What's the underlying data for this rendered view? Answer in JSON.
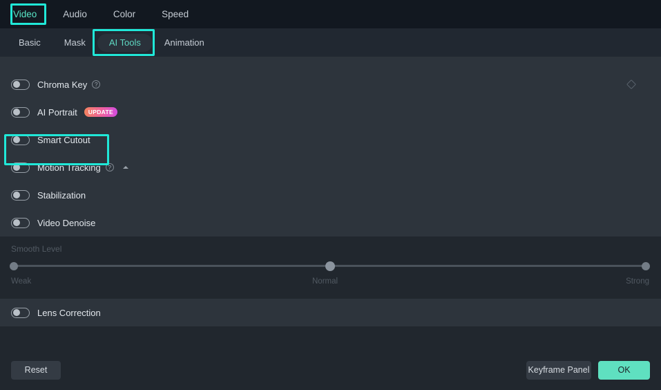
{
  "top_tabs": [
    {
      "label": "Video",
      "active": true,
      "highlighted": true
    },
    {
      "label": "Audio",
      "active": false,
      "highlighted": false
    },
    {
      "label": "Color",
      "active": false,
      "highlighted": false
    },
    {
      "label": "Speed",
      "active": false,
      "highlighted": false
    }
  ],
  "sub_tabs": [
    {
      "label": "Basic",
      "active": false
    },
    {
      "label": "Mask",
      "active": false
    },
    {
      "label": "AI Tools",
      "active": true
    },
    {
      "label": "Animation",
      "active": false
    }
  ],
  "rows": {
    "chroma_key": {
      "label": "Chroma Key",
      "help": "?",
      "keyframe_icon": "diamond-icon",
      "toggle": "off"
    },
    "ai_portrait": {
      "label": "AI Portrait",
      "badge": "UPDATE",
      "toggle": "off"
    },
    "smart_cutout": {
      "label": "Smart Cutout",
      "toggle": "off"
    },
    "motion_tracking": {
      "label": "Motion Tracking",
      "help": "?",
      "caret": "collapse-caret",
      "toggle": "off"
    },
    "stabilization": {
      "label": "Stabilization",
      "toggle": "off"
    },
    "video_denoise": {
      "label": "Video Denoise",
      "toggle": "off",
      "highlighted": true
    },
    "lens_correction": {
      "label": "Lens Correction",
      "toggle": "off"
    }
  },
  "smooth_level": {
    "label": "Smooth Level",
    "ticks": [
      "Weak",
      "Normal",
      "Strong"
    ],
    "selected": "Normal",
    "handle_percent": 50
  },
  "footer": {
    "reset_label": "Reset",
    "keyframe_panel_label": "Keyframe Panel",
    "ok_label": "OK"
  },
  "colors": {
    "accent_highlight": "#20e8d8",
    "tab_active_text": "#59e5c6",
    "ok_button": "#5fe0c0",
    "panel_bg": "#2d343c",
    "dark_bg": "#21272e",
    "topbar_bg": "#121820"
  }
}
